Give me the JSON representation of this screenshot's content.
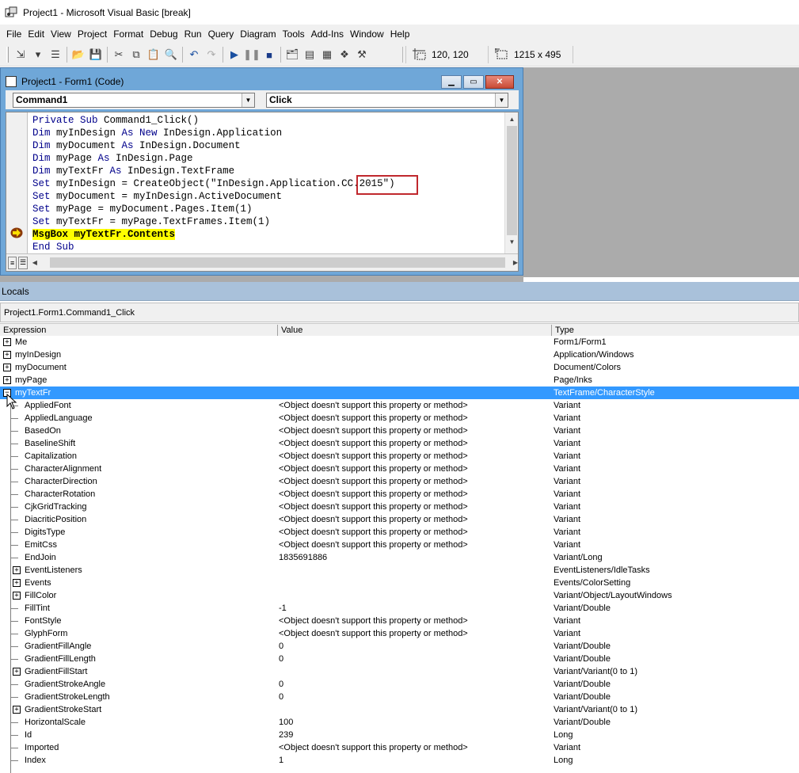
{
  "window": {
    "title": "Project1 - Microsoft Visual Basic [break]"
  },
  "menubar": [
    "File",
    "Edit",
    "View",
    "Project",
    "Format",
    "Debug",
    "Run",
    "Query",
    "Diagram",
    "Tools",
    "Add-Ins",
    "Window",
    "Help"
  ],
  "toolbar": {
    "position_readout": "120, 120",
    "size_readout": "1215 x 495"
  },
  "code_window": {
    "title": "Project1 - Form1 (Code)",
    "object_combo": "Command1",
    "proc_combo": "Click",
    "lines": [
      [
        {
          "t": "Private Sub ",
          "k": true
        },
        {
          "t": "Command1_Click()"
        }
      ],
      [
        {
          "t": "Dim ",
          "k": true
        },
        {
          "t": "myInDesign "
        },
        {
          "t": "As New ",
          "k": true
        },
        {
          "t": "InDesign.Application"
        }
      ],
      [
        {
          "t": "Dim ",
          "k": true
        },
        {
          "t": "myDocument "
        },
        {
          "t": "As ",
          "k": true
        },
        {
          "t": "InDesign.Document"
        }
      ],
      [
        {
          "t": "Dim ",
          "k": true
        },
        {
          "t": "myPage "
        },
        {
          "t": "As ",
          "k": true
        },
        {
          "t": "InDesign.Page"
        }
      ],
      [
        {
          "t": "Dim ",
          "k": true
        },
        {
          "t": "myTextFr "
        },
        {
          "t": "As ",
          "k": true
        },
        {
          "t": "InDesign.TextFrame"
        }
      ],
      [
        {
          "t": "Set ",
          "k": true
        },
        {
          "t": "myInDesign = CreateObject(\"InDesign.Application.CC.2015\")"
        }
      ],
      [
        {
          "t": "Set ",
          "k": true
        },
        {
          "t": "myDocument = myInDesign.ActiveDocument"
        }
      ],
      [
        {
          "t": "Set ",
          "k": true
        },
        {
          "t": "myPage = myDocument.Pages.Item(1)"
        }
      ],
      [
        {
          "t": "Set ",
          "k": true
        },
        {
          "t": "myTextFr = myPage.TextFrames.Item(1)"
        }
      ],
      [
        {
          "t": "MsgBox myTextFr.Contents",
          "h": true
        }
      ],
      [
        {
          "t": "End Sub",
          "k": true
        }
      ]
    ]
  },
  "locals": {
    "title": "Locals",
    "context": "Project1.Form1.Command1_Click",
    "columns": [
      "Expression",
      "Value",
      "Type"
    ],
    "rows": [
      {
        "name": "Me",
        "value": "",
        "type": "Form1/Form1",
        "level": 0,
        "exp": "+"
      },
      {
        "name": "myInDesign",
        "value": "",
        "type": "Application/Windows",
        "level": 0,
        "exp": "+"
      },
      {
        "name": "myDocument",
        "value": "",
        "type": "Document/Colors",
        "level": 0,
        "exp": "+"
      },
      {
        "name": "myPage",
        "value": "",
        "type": "Page/Inks",
        "level": 0,
        "exp": "+"
      },
      {
        "name": "myTextFr",
        "value": "",
        "type": "TextFrame/CharacterStyle",
        "level": 0,
        "exp": "-",
        "selected": true
      },
      {
        "name": "AppliedFont",
        "value": "<Object doesn't support this property or method>",
        "type": "Variant",
        "level": 1
      },
      {
        "name": "AppliedLanguage",
        "value": "<Object doesn't support this property or method>",
        "type": "Variant",
        "level": 1
      },
      {
        "name": "BasedOn",
        "value": "<Object doesn't support this property or method>",
        "type": "Variant",
        "level": 1
      },
      {
        "name": "BaselineShift",
        "value": "<Object doesn't support this property or method>",
        "type": "Variant",
        "level": 1
      },
      {
        "name": "Capitalization",
        "value": "<Object doesn't support this property or method>",
        "type": "Variant",
        "level": 1
      },
      {
        "name": "CharacterAlignment",
        "value": "<Object doesn't support this property or method>",
        "type": "Variant",
        "level": 1
      },
      {
        "name": "CharacterDirection",
        "value": "<Object doesn't support this property or method>",
        "type": "Variant",
        "level": 1
      },
      {
        "name": "CharacterRotation",
        "value": "<Object doesn't support this property or method>",
        "type": "Variant",
        "level": 1
      },
      {
        "name": "CjkGridTracking",
        "value": "<Object doesn't support this property or method>",
        "type": "Variant",
        "level": 1
      },
      {
        "name": "DiacriticPosition",
        "value": "<Object doesn't support this property or method>",
        "type": "Variant",
        "level": 1
      },
      {
        "name": "DigitsType",
        "value": "<Object doesn't support this property or method>",
        "type": "Variant",
        "level": 1
      },
      {
        "name": "EmitCss",
        "value": "<Object doesn't support this property or method>",
        "type": "Variant",
        "level": 1
      },
      {
        "name": "EndJoin",
        "value": "1835691886",
        "type": "Variant/Long",
        "level": 1
      },
      {
        "name": "EventListeners",
        "value": "",
        "type": "EventListeners/IdleTasks",
        "level": 1,
        "exp": "+"
      },
      {
        "name": "Events",
        "value": "",
        "type": "Events/ColorSetting",
        "level": 1,
        "exp": "+"
      },
      {
        "name": "FillColor",
        "value": "",
        "type": "Variant/Object/LayoutWindows",
        "level": 1,
        "exp": "+"
      },
      {
        "name": "FillTint",
        "value": "-1",
        "type": "Variant/Double",
        "level": 1
      },
      {
        "name": "FontStyle",
        "value": "<Object doesn't support this property or method>",
        "type": "Variant",
        "level": 1
      },
      {
        "name": "GlyphForm",
        "value": "<Object doesn't support this property or method>",
        "type": "Variant",
        "level": 1
      },
      {
        "name": "GradientFillAngle",
        "value": "0",
        "type": "Variant/Double",
        "level": 1
      },
      {
        "name": "GradientFillLength",
        "value": "0",
        "type": "Variant/Double",
        "level": 1
      },
      {
        "name": "GradientFillStart",
        "value": "",
        "type": "Variant/Variant(0 to 1)",
        "level": 1,
        "exp": "+"
      },
      {
        "name": "GradientStrokeAngle",
        "value": "0",
        "type": "Variant/Double",
        "level": 1
      },
      {
        "name": "GradientStrokeLength",
        "value": "0",
        "type": "Variant/Double",
        "level": 1
      },
      {
        "name": "GradientStrokeStart",
        "value": "",
        "type": "Variant/Variant(0 to 1)",
        "level": 1,
        "exp": "+"
      },
      {
        "name": "HorizontalScale",
        "value": "100",
        "type": "Variant/Double",
        "level": 1
      },
      {
        "name": "Id",
        "value": "239",
        "type": "Long",
        "level": 1
      },
      {
        "name": "Imported",
        "value": "<Object doesn't support this property or method>",
        "type": "Variant",
        "level": 1
      },
      {
        "name": "Index",
        "value": "1",
        "type": "Long",
        "level": 1
      }
    ]
  }
}
